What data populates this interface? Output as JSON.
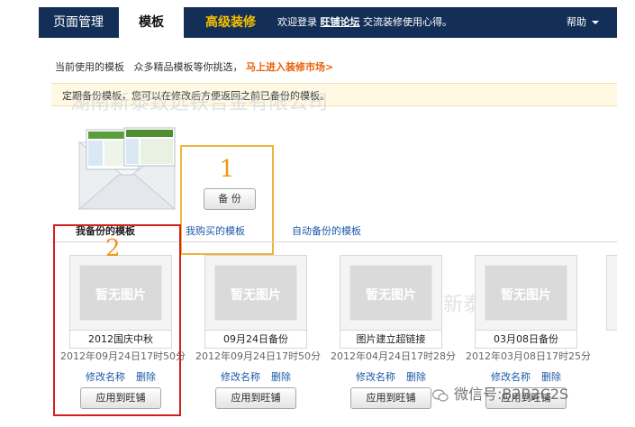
{
  "topbar": {
    "title": "页面管理",
    "active_tab": "模板",
    "advanced": "高级装修",
    "welcome_prefix": "欢迎登录",
    "forum_link": "旺铺论坛",
    "welcome_suffix": "交流装修使用心得。",
    "help": "帮助"
  },
  "current": {
    "label": "当前使用的模板",
    "hint": "众多精品模板等你挑选，",
    "market_link": "马上进入装修市场>"
  },
  "notice": "定期备份模板，您可以在修改后方便返回之前已备份的模板。",
  "backup": {
    "number": "1",
    "button": "备 份"
  },
  "tabs": {
    "mine": "我备份的模板",
    "bought": "我购买的模板",
    "auto": "自动备份的模板"
  },
  "highlight_number": "2",
  "cards": [
    {
      "thumb": "暂无图片",
      "name": "2012国庆中秋",
      "time": "2012年09月24日17时50分",
      "edit": "修改名称",
      "delete": "删除",
      "apply": "应用到旺铺"
    },
    {
      "thumb": "暂无图片",
      "name": "09月24日备份",
      "time": "2012年09月24日17时50分",
      "edit": "修改名称",
      "delete": "删除",
      "apply": "应用到旺铺"
    },
    {
      "thumb": "暂无图片",
      "name": "图片建立超链接",
      "time": "2012年04月24日17时28分",
      "edit": "修改名称",
      "delete": "删除",
      "apply": "应用到旺铺"
    },
    {
      "thumb": "暂无图片",
      "name": "03月08日备份",
      "time": "2012年03月08日17时25分",
      "edit": "修改名称",
      "delete": "删除",
      "apply": "应用到旺铺"
    }
  ],
  "watermarks": {
    "top": "湖南新泰致远铁合金有限公司",
    "mid": "湖南新泰致远铁合"
  },
  "wechat": "微信号:B2B2C2S",
  "colors": {
    "nav_bg": "#142f57",
    "accent_yellow": "#f7c100",
    "link_orange": "#e8610b",
    "link_blue": "#1b5aa6",
    "box_orange": "#f0b43c",
    "box_red": "#d31e1e"
  }
}
